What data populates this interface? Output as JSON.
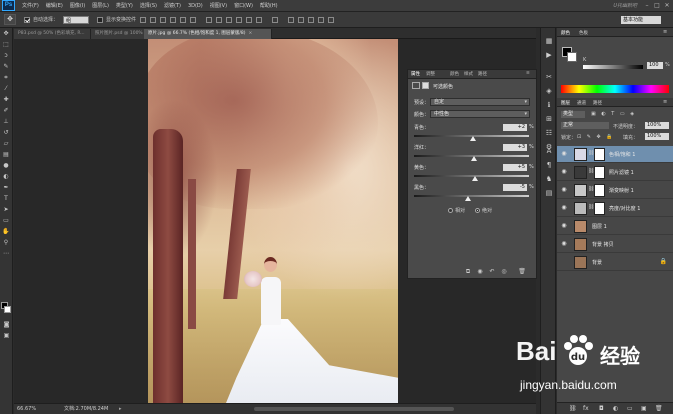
{
  "menubar": {
    "logo": "Ps",
    "items": [
      "文件(F)",
      "编辑(E)",
      "图像(I)",
      "图层(L)",
      "类型(Y)",
      "选择(S)",
      "滤镜(T)",
      "3D(D)",
      "视图(V)",
      "窗口(W)",
      "帮助(H)"
    ],
    "watermark": "U托幽默吧"
  },
  "options": {
    "auto_select_label": "自动选择：",
    "auto_select_value": "组",
    "transform_label": "显示变换控件",
    "workspace": "基本功能"
  },
  "tabs": [
    {
      "label": "P83.psd @ 50% (色彩填充, R...",
      "active": false
    },
    {
      "label": "照片图片.psd @ 100% (图层...",
      "active": false
    },
    {
      "label": "原片.jpg @ 66.7% (色相/饱和度 1, 图层蒙版/8)",
      "active": true
    }
  ],
  "properties": {
    "tabs": [
      "属性",
      "调整",
      "颜色",
      "样式",
      "路径"
    ],
    "title": "可选颜色",
    "preset_label": "预设：",
    "preset_value": "自定",
    "colors_label": "颜色：",
    "colors_value": "中性色",
    "sliders": [
      {
        "label": "青色：",
        "value": "+2",
        "pct": "%",
        "level": 0.51
      },
      {
        "label": "洋红：",
        "value": "+3",
        "pct": "%",
        "level": 0.52
      },
      {
        "label": "黄色：",
        "value": "+5",
        "pct": "%",
        "level": 0.53
      },
      {
        "label": "黑色：",
        "value": "-5",
        "pct": "%",
        "level": 0.47
      }
    ],
    "method_relative": "相对",
    "method_absolute": "绝对",
    "method_selected": "absolute"
  },
  "status": {
    "zoom": "66.67%",
    "doc": "文档:2.70M/8.24M"
  },
  "colorpanel": {
    "tabs": [
      "颜色",
      "色板"
    ],
    "k_label": "K",
    "k_value": "100",
    "k_pct": "%"
  },
  "layers": {
    "tabs": [
      "图层",
      "通道",
      "路径"
    ],
    "kind_label": "类型",
    "blend_mode": "正常",
    "opacity_label": "不透明度：",
    "opacity_value": "100%",
    "lock_label": "锁定：",
    "fill_label": "填充：",
    "fill_value": "100%",
    "items": [
      {
        "name": "色相/饱和 1",
        "selected": true,
        "has_mask": true,
        "thumb": "#d9d9e6",
        "visible": true
      },
      {
        "name": "照片滤镜 1",
        "selected": false,
        "has_mask": true,
        "thumb": "#3a3a3a",
        "visible": true
      },
      {
        "name": "渐变映射 1",
        "selected": false,
        "has_mask": true,
        "thumb": "#c8c8c8",
        "visible": true
      },
      {
        "name": "亮度/对比度 1",
        "selected": false,
        "has_mask": true,
        "thumb": "#bbbbbb",
        "visible": true
      },
      {
        "name": "图层 1",
        "selected": false,
        "has_mask": false,
        "thumb": "#b98a6a",
        "visible": true
      },
      {
        "name": "背景 拷贝",
        "selected": false,
        "has_mask": false,
        "thumb": "#a57a5a",
        "visible": true
      },
      {
        "name": "背景",
        "selected": false,
        "has_mask": false,
        "thumb": "#9b7558",
        "visible": false,
        "locked": true
      }
    ]
  },
  "watermark": {
    "brand_left": "Bai",
    "brand_right": "经验",
    "url": "jingyan.baidu.com"
  }
}
